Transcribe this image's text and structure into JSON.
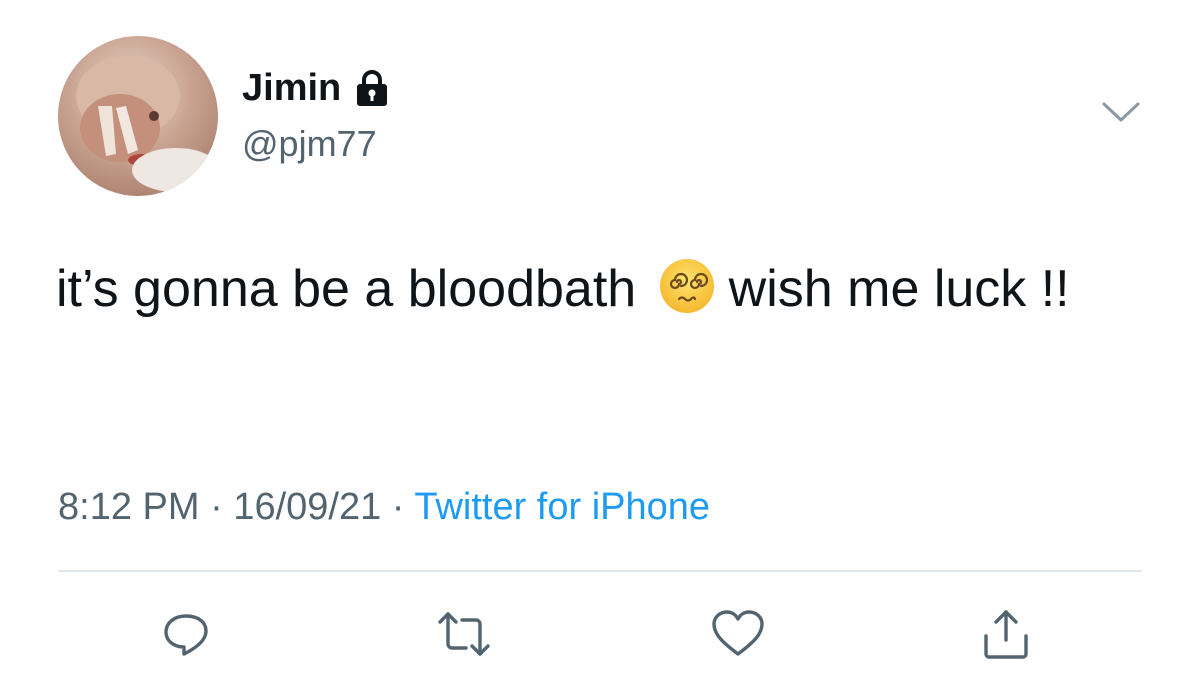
{
  "tweet": {
    "author": {
      "display_name": "Jimin",
      "handle": "@pjm77",
      "protected_icon": "lock-icon"
    },
    "text_part1": "it’s gonna be a bloodbath",
    "emoji": "face-with-spiral-eyes",
    "text_part2": "wish me luck !!",
    "time": "8:12 PM",
    "separator": "·",
    "date": "16/09/21",
    "source": "Twitter for iPhone"
  },
  "actions": [
    {
      "name": "reply",
      "icon": "reply-icon"
    },
    {
      "name": "retweet",
      "icon": "retweet-icon"
    },
    {
      "name": "like",
      "icon": "heart-icon"
    },
    {
      "name": "share",
      "icon": "share-icon"
    }
  ],
  "colors": {
    "text": "#0f1419",
    "secondary": "#536471",
    "link": "#1d9bf0",
    "divider": "#e1e6ea"
  }
}
